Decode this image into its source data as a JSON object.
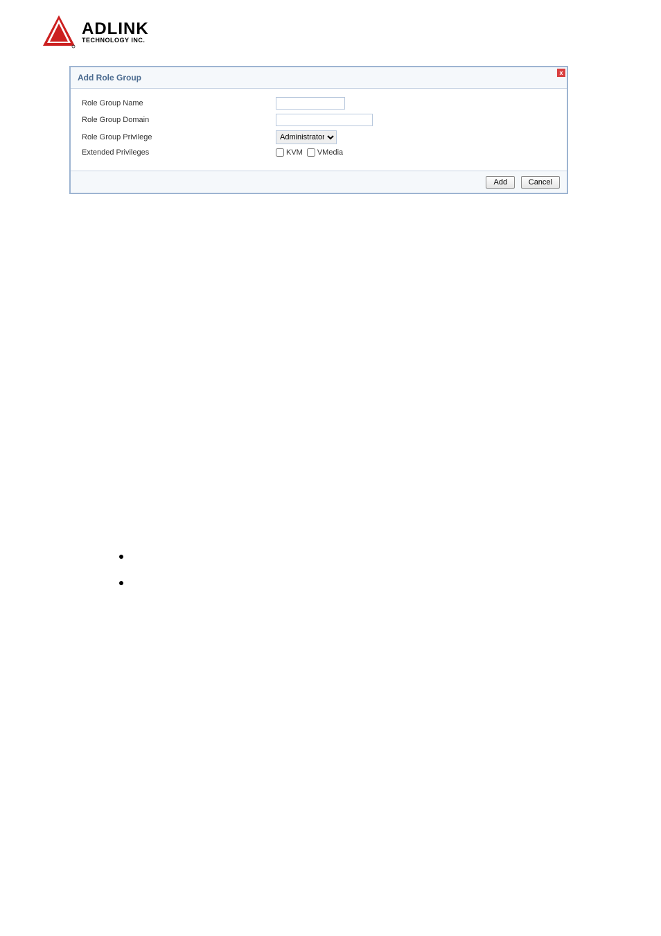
{
  "logo": {
    "main": "ADLINK",
    "sub": "TECHNOLOGY INC."
  },
  "dialog": {
    "title": "Add Role Group",
    "close": "x",
    "fields": {
      "name": {
        "label": "Role Group Name",
        "value": ""
      },
      "domain": {
        "label": "Role Group Domain",
        "value": ""
      },
      "privilege": {
        "label": "Role Group Privilege",
        "selected": "Administrator"
      },
      "extended": {
        "label": "Extended Privileges",
        "kvm_label": "KVM",
        "vmedia_label": "VMedia"
      }
    },
    "buttons": {
      "add": "Add",
      "cancel": "Cancel"
    }
  }
}
